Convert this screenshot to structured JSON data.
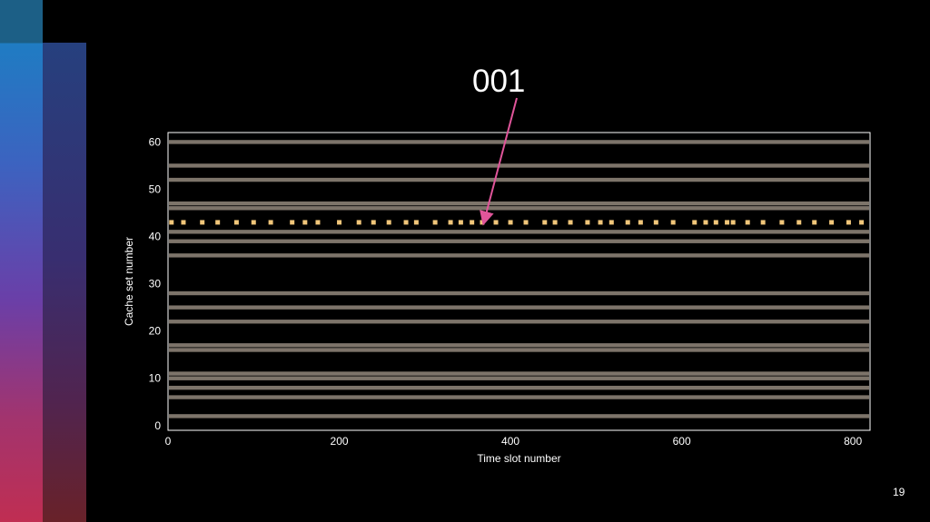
{
  "slide": {
    "title": "001",
    "page_number": "19",
    "colors": {
      "background": "#000000",
      "accent_bar_top": "#1f7cc3",
      "accent_bar_bottom": "#c02e52",
      "annotation_arrow": "#e0559a"
    }
  },
  "chart_data": {
    "type": "heatmap",
    "xlabel": "Time slot number",
    "ylabel": "Cache set number",
    "xlim": [
      0,
      820
    ],
    "ylim": [
      -1,
      62
    ],
    "x_ticks": [
      0,
      200,
      400,
      600,
      800
    ],
    "y_ticks": [
      0,
      10,
      20,
      30,
      40,
      50,
      60
    ],
    "busy_cache_sets": [
      2,
      6,
      8,
      10,
      11,
      16,
      17,
      22,
      25,
      28,
      36,
      39,
      41,
      46,
      47,
      52,
      55,
      60
    ],
    "highlighted_cache_set": 43,
    "highlighted_access_times": [
      4,
      18,
      40,
      58,
      80,
      100,
      120,
      145,
      160,
      175,
      200,
      223,
      240,
      258,
      278,
      290,
      312,
      330,
      342,
      355,
      367,
      383,
      400,
      418,
      440,
      452,
      470,
      490,
      505,
      518,
      537,
      552,
      570,
      590,
      615,
      628,
      640,
      653,
      660,
      677,
      695,
      717,
      737,
      755,
      775,
      795,
      810
    ],
    "annotation": {
      "text": "001",
      "points_to": [
        370,
        43
      ]
    },
    "colors": {
      "busy": "#7d746a",
      "highlight": "#f1c67a",
      "frame": "#ffffff"
    }
  }
}
